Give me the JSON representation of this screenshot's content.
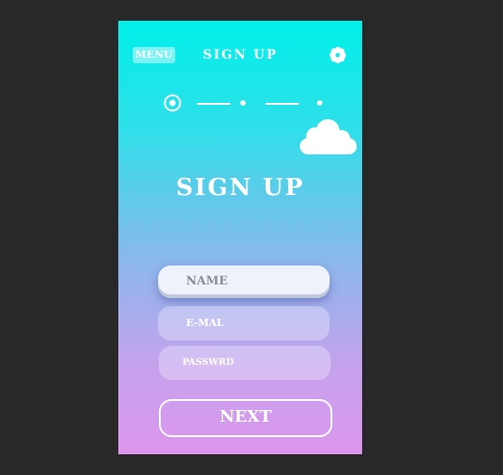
{
  "header": {
    "menu_label": "MENU",
    "title": "SIGN  UP",
    "settings_icon": "gear-icon"
  },
  "progress": {
    "total_steps": 3,
    "current_step": 1
  },
  "main": {
    "title": "SIGN  UP"
  },
  "form": {
    "name_placeholder": "NAME",
    "email_placeholder": "E-MAL",
    "password_placeholder": "PASSWRD"
  },
  "actions": {
    "next_label": "NEXT"
  },
  "colors": {
    "gradient_top": "#00f0ea",
    "gradient_bottom": "#dc96ec",
    "background": "#282828"
  }
}
